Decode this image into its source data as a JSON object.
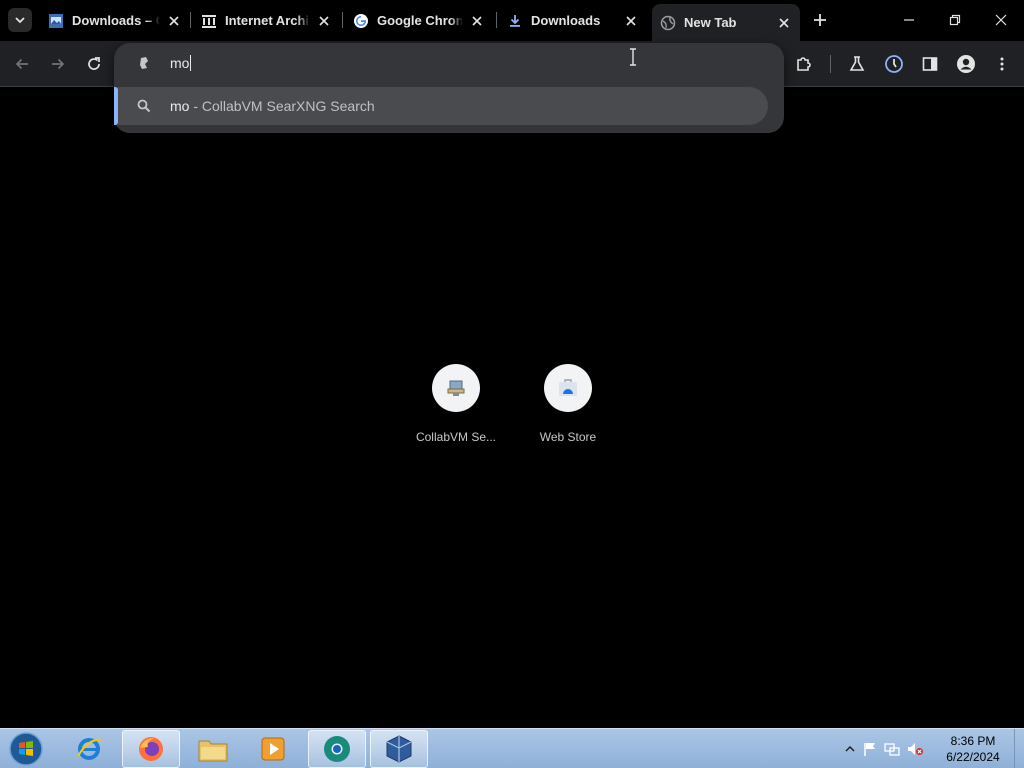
{
  "tabs": [
    {
      "title": "Downloads – C",
      "favicon": "page-icon"
    },
    {
      "title": "Internet Archiv",
      "favicon": "archive-icon"
    },
    {
      "title": "Google Chrom",
      "favicon": "google-icon"
    },
    {
      "title": "Downloads",
      "favicon": "download-icon"
    },
    {
      "title": "New Tab",
      "favicon": "globe-icon"
    }
  ],
  "omnibox": {
    "input_value": "mo",
    "suggestion": {
      "query": "mo",
      "separator": " - ",
      "provider": "CollabVM SearXNG Search"
    }
  },
  "shortcuts": [
    {
      "label": "CollabVM Se...",
      "icon": "collabvm-icon"
    },
    {
      "label": "Web Store",
      "icon": "webstore-icon"
    }
  ],
  "taskbar": {
    "apps": [
      "internet-explorer-icon",
      "firefox-icon",
      "file-explorer-icon",
      "media-player-icon",
      "chrome-canary-icon",
      "virtualbox-icon"
    ]
  },
  "clock": {
    "time": "8:36 PM",
    "date": "6/22/2024"
  },
  "colors": {
    "accent": "#8ab4f8",
    "toolbar": "#202124",
    "omnibox": "#35363a"
  }
}
